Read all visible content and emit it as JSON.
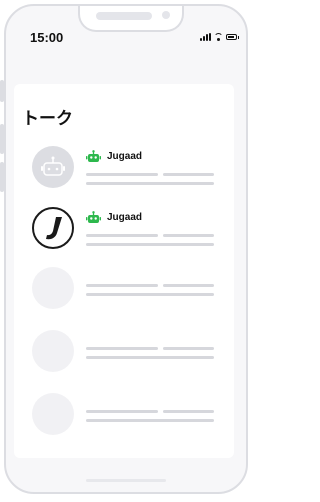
{
  "status_bar": {
    "time": "15:00"
  },
  "header": {
    "title": "トーク"
  },
  "conversations": [
    {
      "name": "Jugaad",
      "avatar": "bot-avatar-icon",
      "tag_icon": "robot-icon"
    },
    {
      "name": "Jugaad",
      "avatar": "jugaad-logo-icon",
      "tag_icon": "robot-icon"
    }
  ],
  "placeholder_rows": 3,
  "colors": {
    "robot_green": "#2db84d",
    "placeholder": "#d6d7dc",
    "frame": "#dcdde2"
  }
}
